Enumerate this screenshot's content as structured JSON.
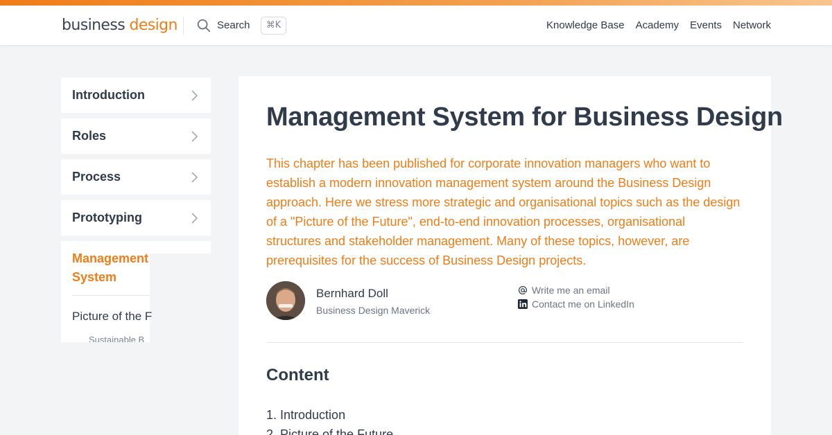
{
  "header": {
    "logo_part1": "business",
    "logo_part2": "design",
    "search_label": "Search",
    "search_shortcut": "⌘K",
    "nav": [
      "Knowledge Base",
      "Academy",
      "Events",
      "Network"
    ]
  },
  "sidebar": {
    "items": [
      {
        "label": "Introduction"
      },
      {
        "label": "Roles"
      },
      {
        "label": "Process"
      },
      {
        "label": "Prototyping"
      }
    ],
    "active": {
      "label": "Management System",
      "sub_item": "Picture of the F",
      "sub_sub_item": "Sustainable B"
    }
  },
  "article": {
    "title": "Management System for Business Design",
    "lead": "This chapter has been published for corporate innovation managers who want to establish a modern innovation management system around the Business Design approach. Here we stress more strategic and organisational topics such as the design of a \"Picture of the Future\", end-to-end innovation processes, organisational structures and stakeholder management. Many of these topics, however, are prerequisites for the success of Business Design projects.",
    "author": {
      "name": "Bernhard Doll",
      "role": "Business Design Maverick",
      "email_link": "Write me an email",
      "linkedin_link": "Contact me on LinkedIn"
    },
    "content_heading": "Content",
    "toc": [
      "1. Introduction",
      "2. Picture of the Future"
    ]
  },
  "colors": {
    "accent": "#ef7d17",
    "text": "#2f3a4a",
    "background": "#f3f4f6"
  }
}
